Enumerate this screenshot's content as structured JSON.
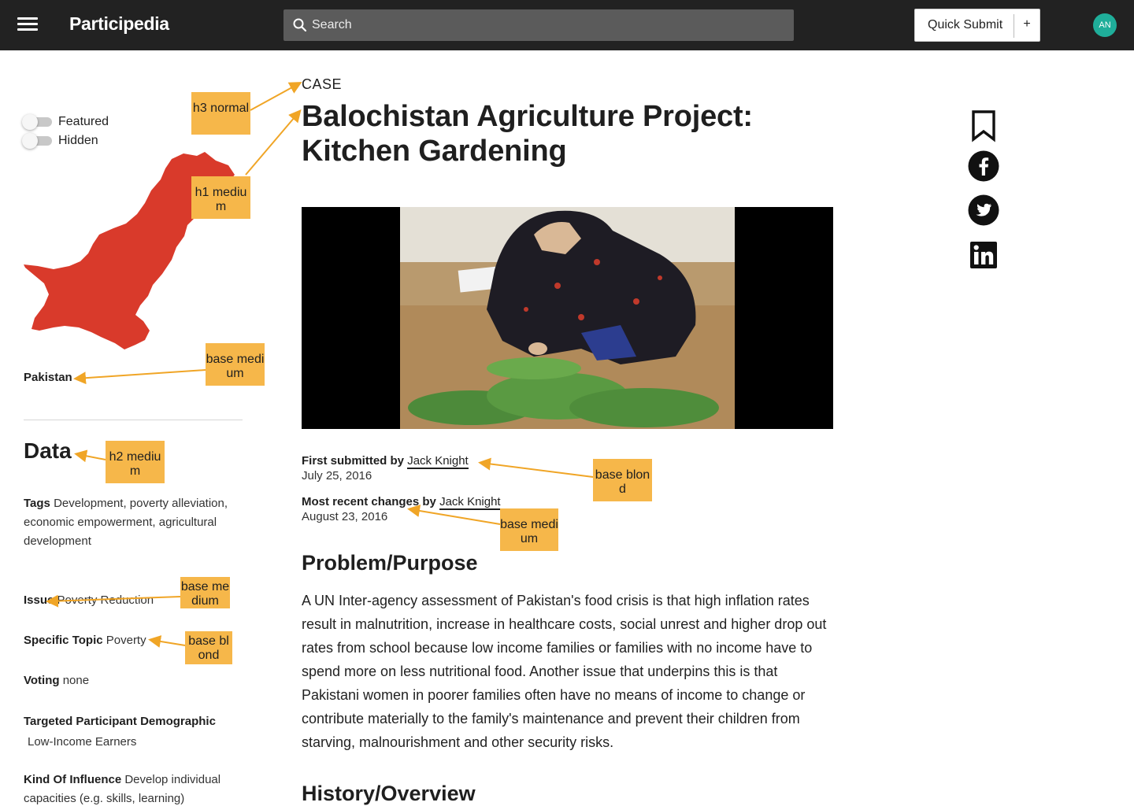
{
  "header": {
    "brand": "Participedia",
    "search_placeholder": "Search",
    "quick_submit_label": "Quick Submit",
    "quick_submit_plus": "+",
    "avatar_initials": "AN"
  },
  "sidebar": {
    "toggles": [
      {
        "label": "Featured",
        "on": false
      },
      {
        "label": "Hidden",
        "on": false
      }
    ],
    "map_color": "#d93a2b",
    "country": "Pakistan",
    "data_title": "Data",
    "fields": [
      {
        "label": "Tags",
        "value": "Development, poverty alleviation, economic empowerment, agricultural development"
      },
      {
        "label": "Issue",
        "value": "Poverty Reduction"
      },
      {
        "label": "Specific Topic",
        "value": "Poverty"
      },
      {
        "label": "Voting",
        "value": "none"
      },
      {
        "label": "Targeted Participant Demographic",
        "value": "Low-Income Earners"
      },
      {
        "label": "Kind Of Influence",
        "value": "Develop individual capacities (e.g. skills, learning)"
      }
    ]
  },
  "article": {
    "kicker": "CASE",
    "title": "Balochistan Agriculture Project: Kitchen Gardening",
    "submitted": {
      "label": "First submitted by",
      "author": "Jack Knight",
      "date": "July 25, 2016"
    },
    "changed": {
      "label": "Most recent changes by",
      "author": "Jack Knight",
      "date": "August 23, 2016"
    },
    "sections": [
      {
        "heading": "Problem/Purpose",
        "body": "A UN Inter-agency assessment of Pakistan's food crisis is that high inflation rates result in malnutrition, increase in healthcare costs, social unrest and higher drop out rates from school because low income families or families with no income have to spend more on less nutritional food. Another issue that underpins this is that Pakistani women in poorer families often have no means of income to change or contribute materially to the family's maintenance and prevent their children from starving, malnourishment and other security risks."
      },
      {
        "heading": "History/Overview",
        "body": ""
      }
    ]
  },
  "share": [
    {
      "icon": "bookmark-icon"
    },
    {
      "icon": "facebook-icon"
    },
    {
      "icon": "twitter-icon"
    },
    {
      "icon": "linkedin-icon"
    }
  ],
  "annotations": [
    {
      "text": "h3 normal"
    },
    {
      "text": "h1 medium"
    },
    {
      "text": "base medium"
    },
    {
      "text": "h2 medium"
    },
    {
      "text": "base medium"
    },
    {
      "text": "base blond"
    },
    {
      "text": "base blond"
    },
    {
      "text": "base medium"
    }
  ],
  "colors": {
    "accent": "#f6b74a",
    "header_bg": "#222222",
    "avatar": "#1fae9a",
    "arrow": "#f0a526"
  }
}
